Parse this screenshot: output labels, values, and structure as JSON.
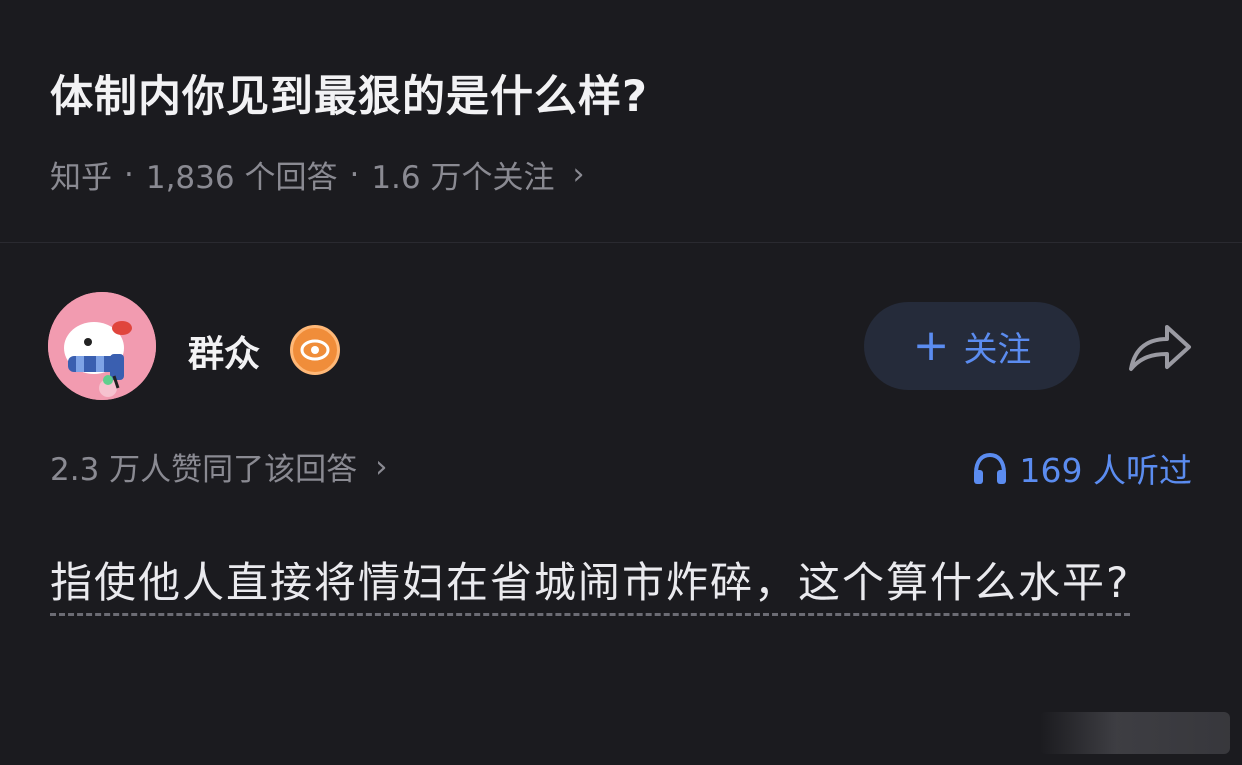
{
  "question": {
    "title": "体制内你见到最狠的是什么样?",
    "source": "知乎",
    "answers": "1,836 个回答",
    "followers": "1.6 万个关注",
    "chevron": "›"
  },
  "author": {
    "name": "群众",
    "follow_label": "关注"
  },
  "stats": {
    "upvotes": "2.3 万人赞同了该回答",
    "listeners": "169 人听过"
  },
  "answer": {
    "text": "指使他人直接将情妇在省城闹市炸碎，这个算什么水平?"
  },
  "colors": {
    "background": "#1b1b1f",
    "accent": "#5b8cf0",
    "badge": "#f08d3a",
    "avatar": "#f29bb0"
  },
  "icons": {
    "follow": "plus-icon",
    "share": "share-arrow-icon",
    "listen": "headphones-icon",
    "badge": "eye-icon"
  }
}
